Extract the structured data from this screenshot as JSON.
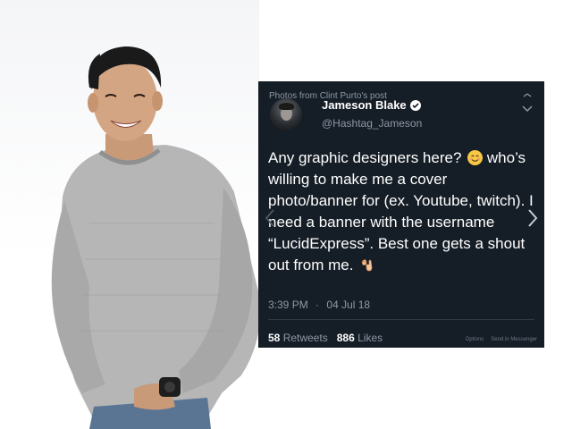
{
  "tweet": {
    "photos_caption": "Photos from Clint Purto's post",
    "author_name": "Jameson Blake",
    "handle": "@Hashtag_Jameson",
    "text_line1": "Any graphic designers here?",
    "text_rest": "who’s willing to make me a cover photo/banner for (ex. Youtube, twitch). I need a banner with the username “LucidExpress”. Best one gets a shout out from me.",
    "time": "3:39 PM",
    "separator": "·",
    "date": "04 Jul 18",
    "retweets_count": "58",
    "retweets_label": "Retweets",
    "likes_count": "886",
    "likes_label": "Likes",
    "options_label": "Options",
    "send_label": "Send in Messenger"
  },
  "colors": {
    "card_bg": "#151d26",
    "muted_text": "#8d99a6",
    "text": "#ffffff"
  },
  "icons": [
    "verified-badge-icon",
    "caret-down-icon",
    "smile-emoji-icon",
    "ok-hand-emoji-icon",
    "previous-arrow-icon",
    "next-arrow-icon"
  ]
}
